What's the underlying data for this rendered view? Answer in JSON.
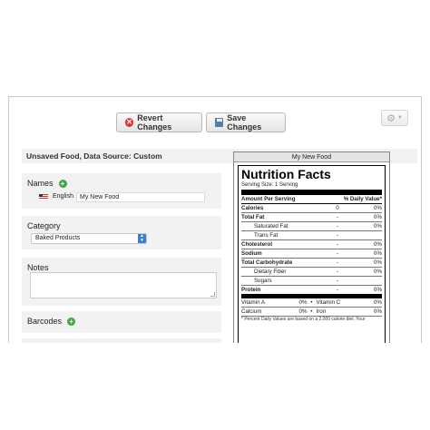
{
  "toolbar": {
    "revert_label": "Revert Changes",
    "save_label": "Save Changes",
    "gear_symbol": "⚙",
    "caret_symbol": "▼"
  },
  "page_title": "Unsaved Food, Data Source: Custom",
  "names": {
    "label": "Names",
    "language": "English",
    "value": "My New Food"
  },
  "category": {
    "label": "Category",
    "selected": "Baked Products"
  },
  "notes": {
    "label": "Notes",
    "value": ""
  },
  "barcodes": {
    "label": "Barcodes"
  },
  "nutrition": {
    "food_name": "My New Food",
    "title": "Nutrition Facts",
    "serving": "Serving Size: 1 Serving",
    "header_amount": "Amount Per Serving",
    "header_dv": "% Daily Value*",
    "rows": [
      {
        "name": "Calories",
        "amount": "0",
        "pct": "0%",
        "style": "bold"
      },
      {
        "name": "Total Fat",
        "amount": "-",
        "pct": "0%",
        "style": "bold"
      },
      {
        "name": "Saturated Fat",
        "amount": "-",
        "pct": "0%",
        "style": "indent"
      },
      {
        "name": "Trans Fat",
        "amount": "-",
        "pct": "",
        "style": "indent"
      },
      {
        "name": "Cholesterol",
        "amount": "-",
        "pct": "0%",
        "style": "bold"
      },
      {
        "name": "Sodium",
        "amount": "-",
        "pct": "0%",
        "style": "bold"
      },
      {
        "name": "Total Carbohydrate",
        "amount": "-",
        "pct": "0%",
        "style": "bold"
      },
      {
        "name": "Dietary Fiber",
        "amount": "-",
        "pct": "0%",
        "style": "indent"
      },
      {
        "name": "Sugars",
        "amount": "-",
        "pct": "",
        "style": "indent"
      },
      {
        "name": "Protein",
        "amount": "-",
        "pct": "0%",
        "style": "bold thick"
      }
    ],
    "vitamins": [
      {
        "left": "Vitamin A",
        "left_pct": "0%",
        "right": "Vitamin C",
        "right_pct": "0%"
      },
      {
        "left": "Calcium",
        "left_pct": "0%",
        "right": "Iron",
        "right_pct": "0%"
      }
    ],
    "footnote": "* Percent Daily Values are based on a 2,000 calorie diet. Your"
  }
}
